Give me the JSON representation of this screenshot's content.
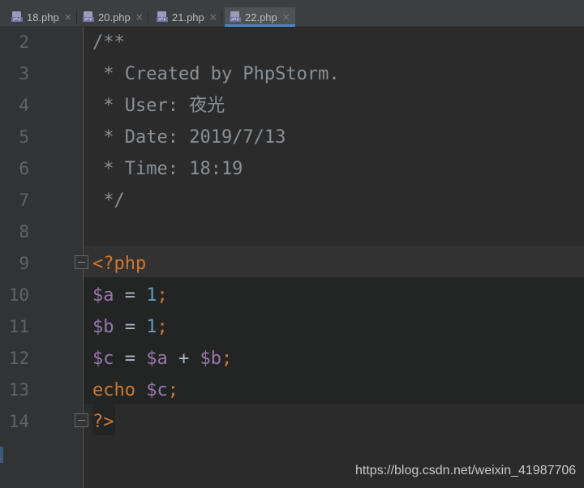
{
  "tabs": [
    {
      "label": "18.php",
      "icon": "php-file-icon",
      "close": "×"
    },
    {
      "label": "20.php",
      "icon": "php-file-icon",
      "close": "×"
    },
    {
      "label": "21.php",
      "icon": "php-file-icon",
      "close": "×"
    },
    {
      "label": "22.php",
      "icon": "php-file-icon",
      "close": "×",
      "active": true
    }
  ],
  "file_icon_badge": "php",
  "lines": [
    {
      "num": "2",
      "text": "/**"
    },
    {
      "num": "3",
      "text": " * Created by PhpStorm."
    },
    {
      "num": "4",
      "text": " * User: 夜光"
    },
    {
      "num": "5",
      "text": " * Date: 2019/7/13"
    },
    {
      "num": "6",
      "text": " * Time: 18:19"
    },
    {
      "num": "7",
      "text": " */"
    },
    {
      "num": "8",
      "text": ""
    },
    {
      "num": "9",
      "open_tag": "<?php"
    },
    {
      "num": "10",
      "var": "$a",
      "op": " = ",
      "val": "1",
      "semi": ";"
    },
    {
      "num": "11",
      "var": "$b",
      "op": " = ",
      "val": "1",
      "semi": ";"
    },
    {
      "num": "12",
      "var": "$c",
      "op": " = ",
      "var2": "$a",
      "op2": " + ",
      "var3": "$b",
      "semi": ";"
    },
    {
      "num": "13",
      "kw": "echo",
      "sp": " ",
      "var": "$c",
      "semi": ";"
    },
    {
      "num": "14",
      "close_tag": "?>"
    }
  ],
  "colors": {
    "background": "#2b2b2b",
    "gutter": "#313335",
    "doc_comment": "#8a9096",
    "keyword": "#cc7832",
    "variable": "#9876aa",
    "number": "#6897bb",
    "default_text": "#a9b7c6",
    "active_tab_underline": "#4a88c7"
  },
  "watermark": "https://blog.csdn.net/weixin_41987706"
}
